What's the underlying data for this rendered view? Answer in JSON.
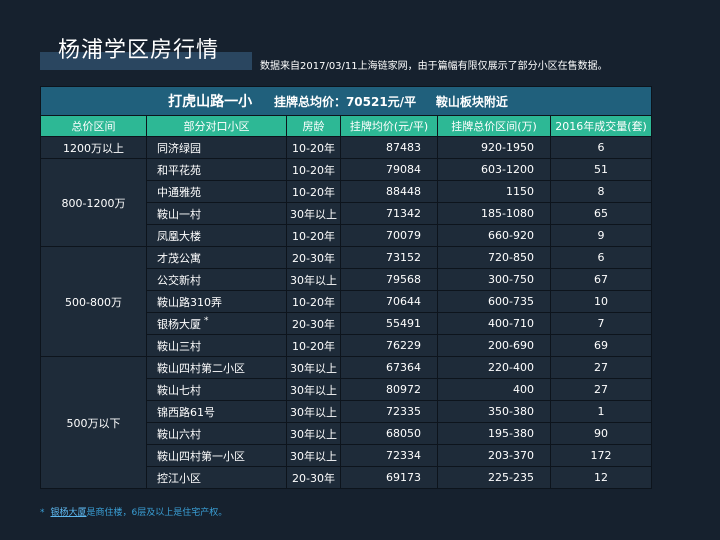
{
  "page": {
    "title": "杨浦学区房行情",
    "subtitle": "数据来自2017/03/11上海链家网，由于篇幅有限仅展示了部分小区在售数据。"
  },
  "table": {
    "school": "打虎山路一小",
    "avg_price": "挂牌总均价：70521元/平",
    "area": "鞍山板块附近",
    "headers": [
      "总价区间",
      "部分对口小区",
      "房龄",
      "挂牌均价(元/平)",
      "挂牌总价区间(万)",
      "2016年成交量(套)"
    ],
    "groups": [
      {
        "range": "1200万以上",
        "rows": [
          {
            "name": "同济绿园",
            "age": "10-20年",
            "price": "87483",
            "total": "920-1950",
            "volume": "6"
          }
        ]
      },
      {
        "range": "800-1200万",
        "rows": [
          {
            "name": "和平花苑",
            "age": "10-20年",
            "price": "79084",
            "total": "603-1200",
            "volume": "51"
          },
          {
            "name": "中通雅苑",
            "age": "10-20年",
            "price": "88448",
            "total": "1150",
            "volume": "8"
          },
          {
            "name": "鞍山一村",
            "age": "30年以上",
            "price": "71342",
            "total": "185-1080",
            "volume": "65"
          },
          {
            "name": "凤凰大楼",
            "age": "10-20年",
            "price": "70079",
            "total": "660-920",
            "volume": "9"
          }
        ]
      },
      {
        "range": "500-800万",
        "rows": [
          {
            "name": "才茂公寓",
            "age": "20-30年",
            "price": "73152",
            "total": "720-850",
            "volume": "6"
          },
          {
            "name": "公交新村",
            "age": "30年以上",
            "price": "79568",
            "total": "300-750",
            "volume": "67"
          },
          {
            "name": "鞍山路310弄",
            "age": "10-20年",
            "price": "70644",
            "total": "600-735",
            "volume": "10"
          },
          {
            "name": "银杨大厦",
            "star": "*",
            "age": "20-30年",
            "price": "55491",
            "total": "400-710",
            "volume": "7"
          },
          {
            "name": "鞍山三村",
            "age": "10-20年",
            "price": "76229",
            "total": "200-690",
            "volume": "69"
          }
        ]
      },
      {
        "range": "500万以下",
        "rows": [
          {
            "name": "鞍山四村第二小区",
            "age": "30年以上",
            "price": "67364",
            "total": "220-400",
            "volume": "27"
          },
          {
            "name": "鞍山七村",
            "age": "30年以上",
            "price": "80972",
            "total": "400",
            "volume": "27"
          },
          {
            "name": "锦西路61号",
            "age": "30年以上",
            "price": "72335",
            "total": "350-380",
            "volume": "1"
          },
          {
            "name": "鞍山六村",
            "age": "30年以上",
            "price": "68050",
            "total": "195-380",
            "volume": "90"
          },
          {
            "name": "鞍山四村第一小区",
            "age": "30年以上",
            "price": "72334",
            "total": "203-370",
            "volume": "172"
          },
          {
            "name": "控江小区",
            "age": "20-30年",
            "price": "69173",
            "total": "225-235",
            "volume": "12"
          }
        ]
      }
    ]
  },
  "footnote": {
    "mark": "*",
    "link": "银杨大厦",
    "text": "是商住楼，6层及以上是住宅产权。"
  }
}
